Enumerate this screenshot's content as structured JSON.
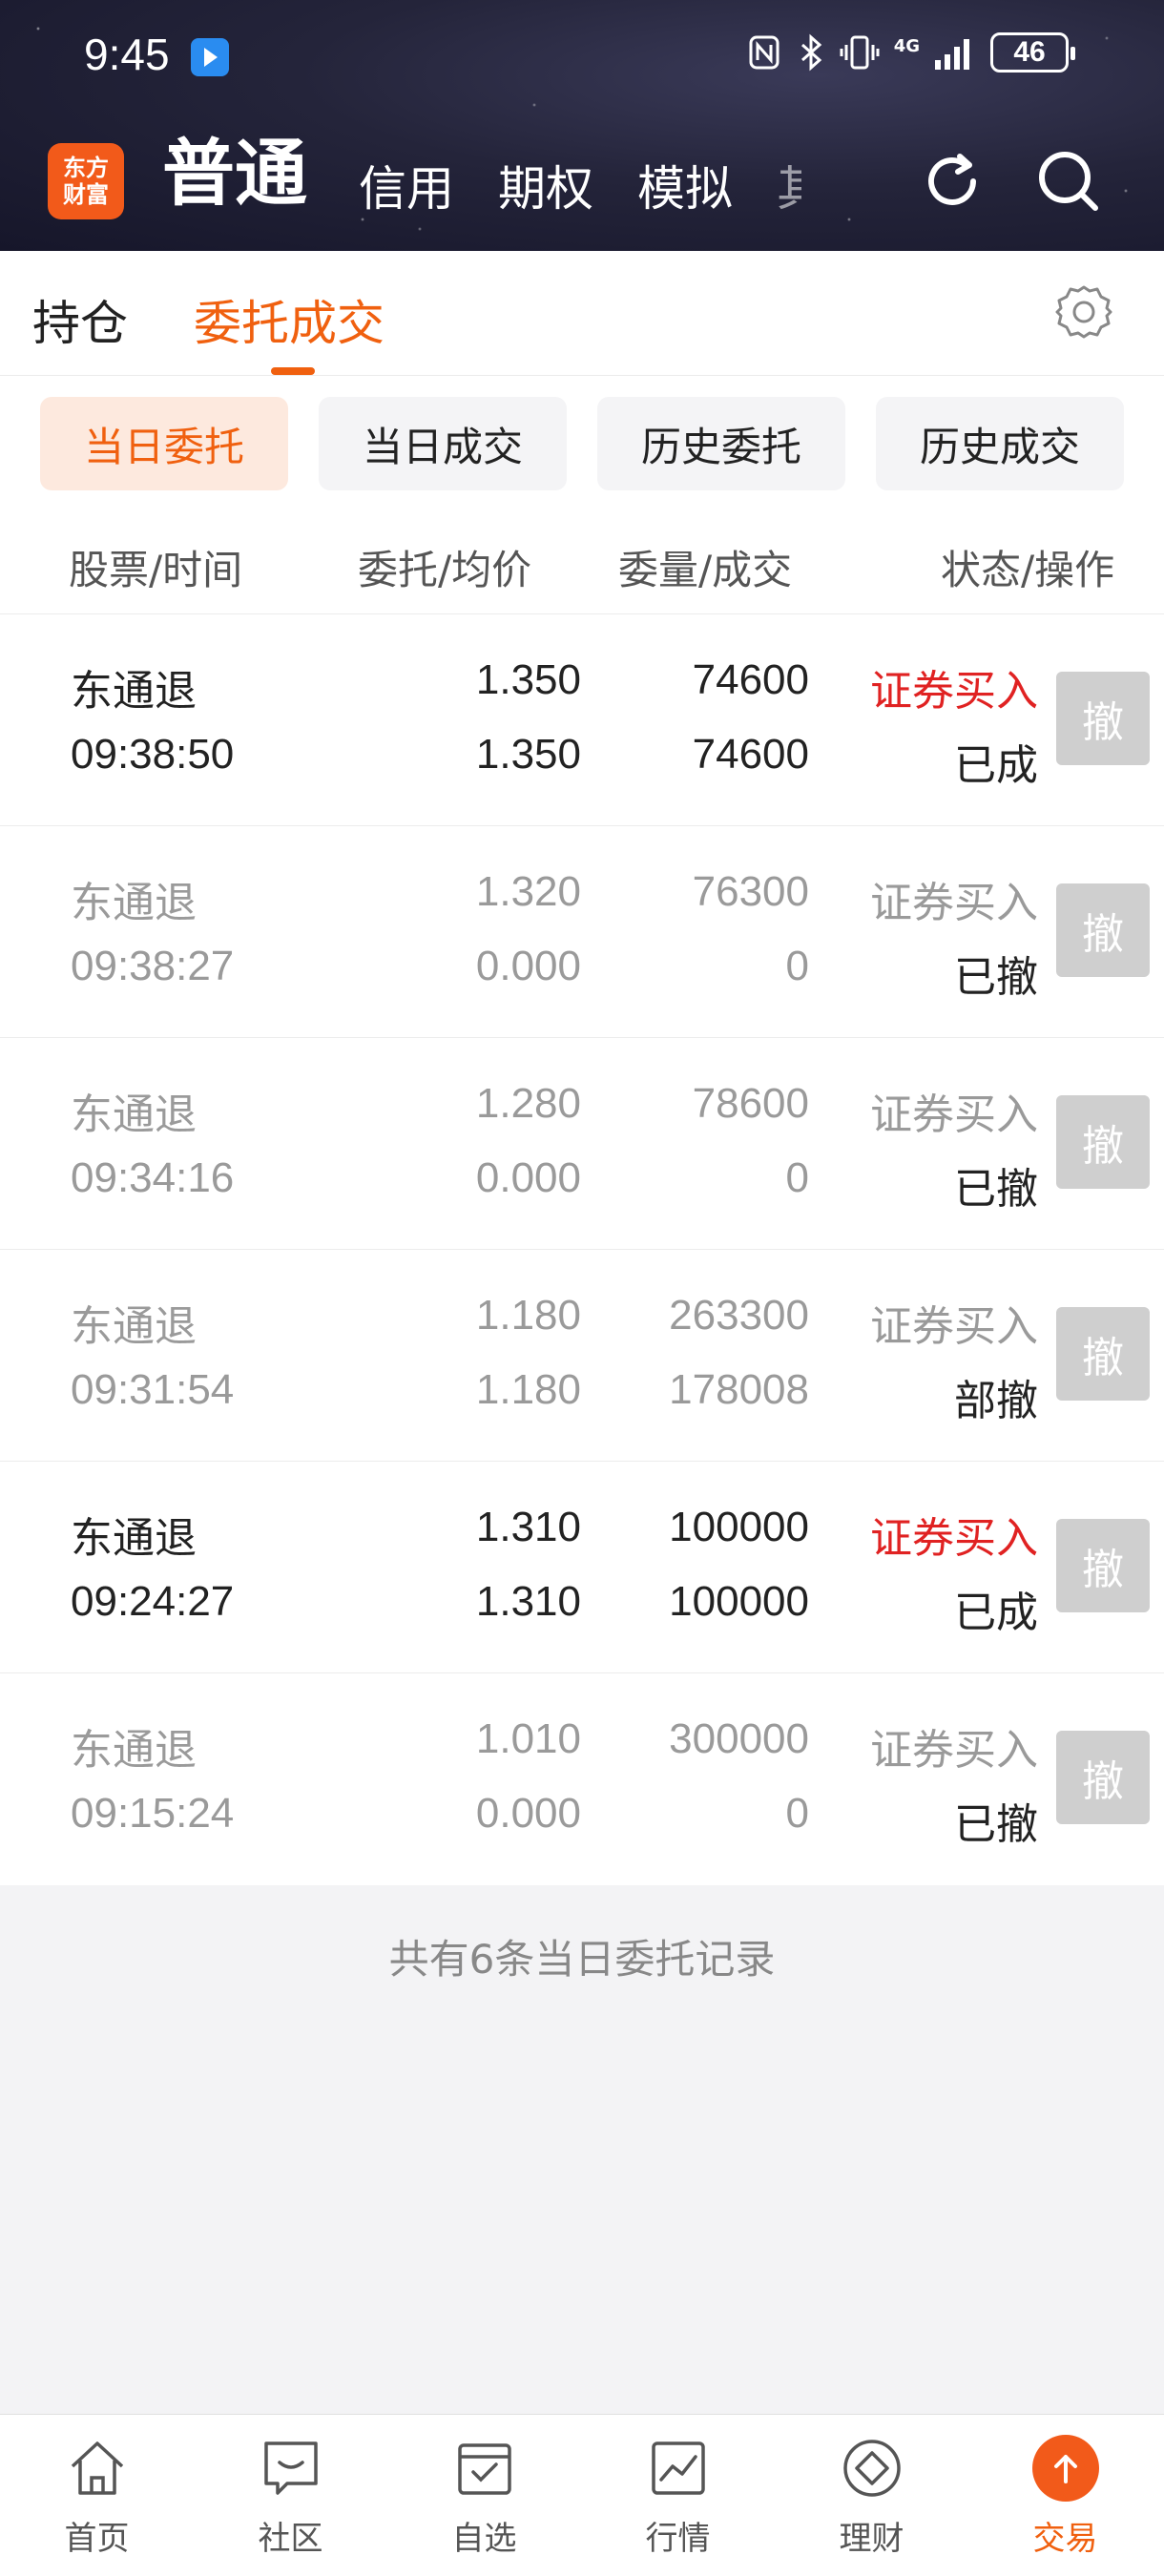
{
  "status_bar": {
    "time": "9:45",
    "battery": "46",
    "network": "4G"
  },
  "header": {
    "logo_line1": "东方",
    "logo_line2": "财富",
    "tabs": [
      {
        "label": "普通",
        "active": true
      },
      {
        "label": "信用"
      },
      {
        "label": "期权"
      },
      {
        "label": "模拟"
      },
      {
        "label": "其"
      }
    ],
    "icons": [
      "refresh-icon",
      "search-icon"
    ]
  },
  "subtabs": {
    "holdings": "持仓",
    "orders": "委托成交",
    "settings_icon": "gear-icon"
  },
  "filters": [
    "当日委托",
    "当日成交",
    "历史委托",
    "历史成交"
  ],
  "columns": {
    "stock_time": "股票/时间",
    "price": "委托/均价",
    "qty": "委量/成交",
    "status": "状态/操作"
  },
  "orders": [
    {
      "name": "东通退",
      "time": "09:38:50",
      "order_price": "1.350",
      "avg_price": "1.350",
      "order_qty": "74600",
      "filled_qty": "74600",
      "side": "证券买入",
      "status": "已成",
      "cancel": "撤"
    },
    {
      "name": "东通退",
      "time": "09:38:27",
      "order_price": "1.320",
      "avg_price": "0.000",
      "order_qty": "76300",
      "filled_qty": "0",
      "side": "证券买入",
      "status": "已撤",
      "cancel": "撤"
    },
    {
      "name": "东通退",
      "time": "09:34:16",
      "order_price": "1.280",
      "avg_price": "0.000",
      "order_qty": "78600",
      "filled_qty": "0",
      "side": "证券买入",
      "status": "已撤",
      "cancel": "撤"
    },
    {
      "name": "东通退",
      "time": "09:31:54",
      "order_price": "1.180",
      "avg_price": "1.180",
      "order_qty": "263300",
      "filled_qty": "178008",
      "side": "证券买入",
      "status": "部撤",
      "cancel": "撤"
    },
    {
      "name": "东通退",
      "time": "09:24:27",
      "order_price": "1.310",
      "avg_price": "1.310",
      "order_qty": "100000",
      "filled_qty": "100000",
      "side": "证券买入",
      "status": "已成",
      "cancel": "撤"
    },
    {
      "name": "东通退",
      "time": "09:15:24",
      "order_price": "1.010",
      "avg_price": "0.000",
      "order_qty": "300000",
      "filled_qty": "0",
      "side": "证券买入",
      "status": "已撤",
      "cancel": "撤"
    }
  ],
  "footer_note": "共有6条当日委托记录",
  "bottom_nav": [
    "首页",
    "社区",
    "自选",
    "行情",
    "理财",
    "交易"
  ],
  "colors": {
    "accent": "#f0600f",
    "buy_red": "#e02222",
    "header_bg": "#24243a"
  }
}
